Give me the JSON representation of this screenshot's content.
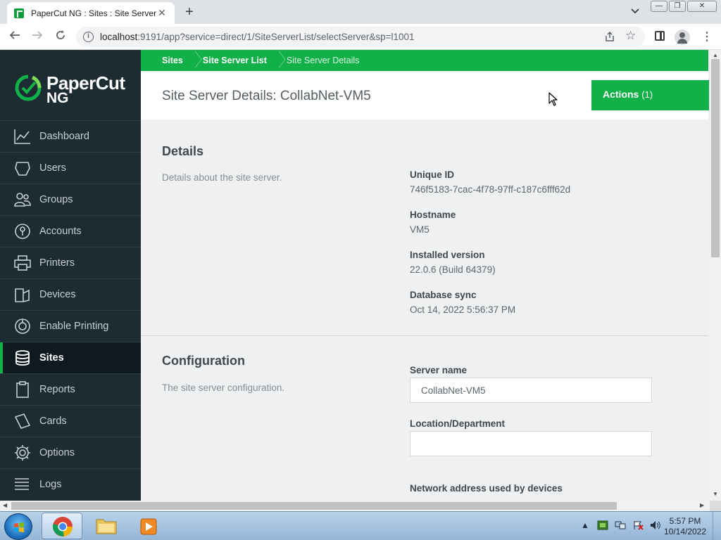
{
  "browser": {
    "tab_title": "PaperCut NG : Sites : Site Server Details",
    "tab_close": "✕",
    "new_tab": "+",
    "url_host": "localhost",
    "url_rest": ":9191/app?service=direct/1/SiteServerList/selectServer&sp=l1001",
    "window_controls": [
      "—",
      "❐",
      "✕"
    ]
  },
  "logo": {
    "line1": "PaperCut",
    "line2": "NG"
  },
  "sidebar": {
    "items": [
      {
        "label": "Dashboard",
        "icon": "dashboard-icon",
        "active": false
      },
      {
        "label": "Users",
        "icon": "users-icon",
        "active": false
      },
      {
        "label": "Groups",
        "icon": "groups-icon",
        "active": false
      },
      {
        "label": "Accounts",
        "icon": "accounts-icon",
        "active": false
      },
      {
        "label": "Printers",
        "icon": "printer-icon",
        "active": false
      },
      {
        "label": "Devices",
        "icon": "device-icon",
        "active": false
      },
      {
        "label": "Enable Printing",
        "icon": "enable-printing-icon",
        "active": false
      },
      {
        "label": "Sites",
        "icon": "database-icon",
        "active": true
      },
      {
        "label": "Reports",
        "icon": "clipboard-icon",
        "active": false
      },
      {
        "label": "Cards",
        "icon": "cards-icon",
        "active": false
      },
      {
        "label": "Options",
        "icon": "gear-icon",
        "active": false
      },
      {
        "label": "Logs",
        "icon": "logs-icon",
        "active": false
      }
    ]
  },
  "breadcrumb": {
    "item1": "Sites",
    "item2": "Site Server List",
    "item3": "Site Server Details"
  },
  "header": {
    "title": "Site Server Details: CollabNet-VM5",
    "actions_label": "Actions",
    "actions_count": "(1)"
  },
  "details": {
    "title": "Details",
    "description": "Details about the site server.",
    "unique_id_label": "Unique ID",
    "unique_id_value": "746f5183-7cac-4f78-97ff-c187c6fff62d",
    "hostname_label": "Hostname",
    "hostname_value": "VM5",
    "version_label": "Installed version",
    "version_value": "22.0.6 (Build 64379)",
    "sync_label": "Database sync",
    "sync_value": "Oct 14, 2022 5:56:37 PM"
  },
  "configuration": {
    "title": "Configuration",
    "description": "The site server configuration.",
    "server_name_label": "Server name",
    "server_name_value": "CollabNet-VM5",
    "location_label": "Location/Department",
    "location_value": "",
    "network_label": "Network address used by devices"
  },
  "taskbar": {
    "time": "5:57 PM",
    "date": "10/14/2022"
  },
  "colors": {
    "brand_green": "#12b048",
    "sidebar_bg": "#1d2c33",
    "content_bg": "#eef0f1"
  }
}
